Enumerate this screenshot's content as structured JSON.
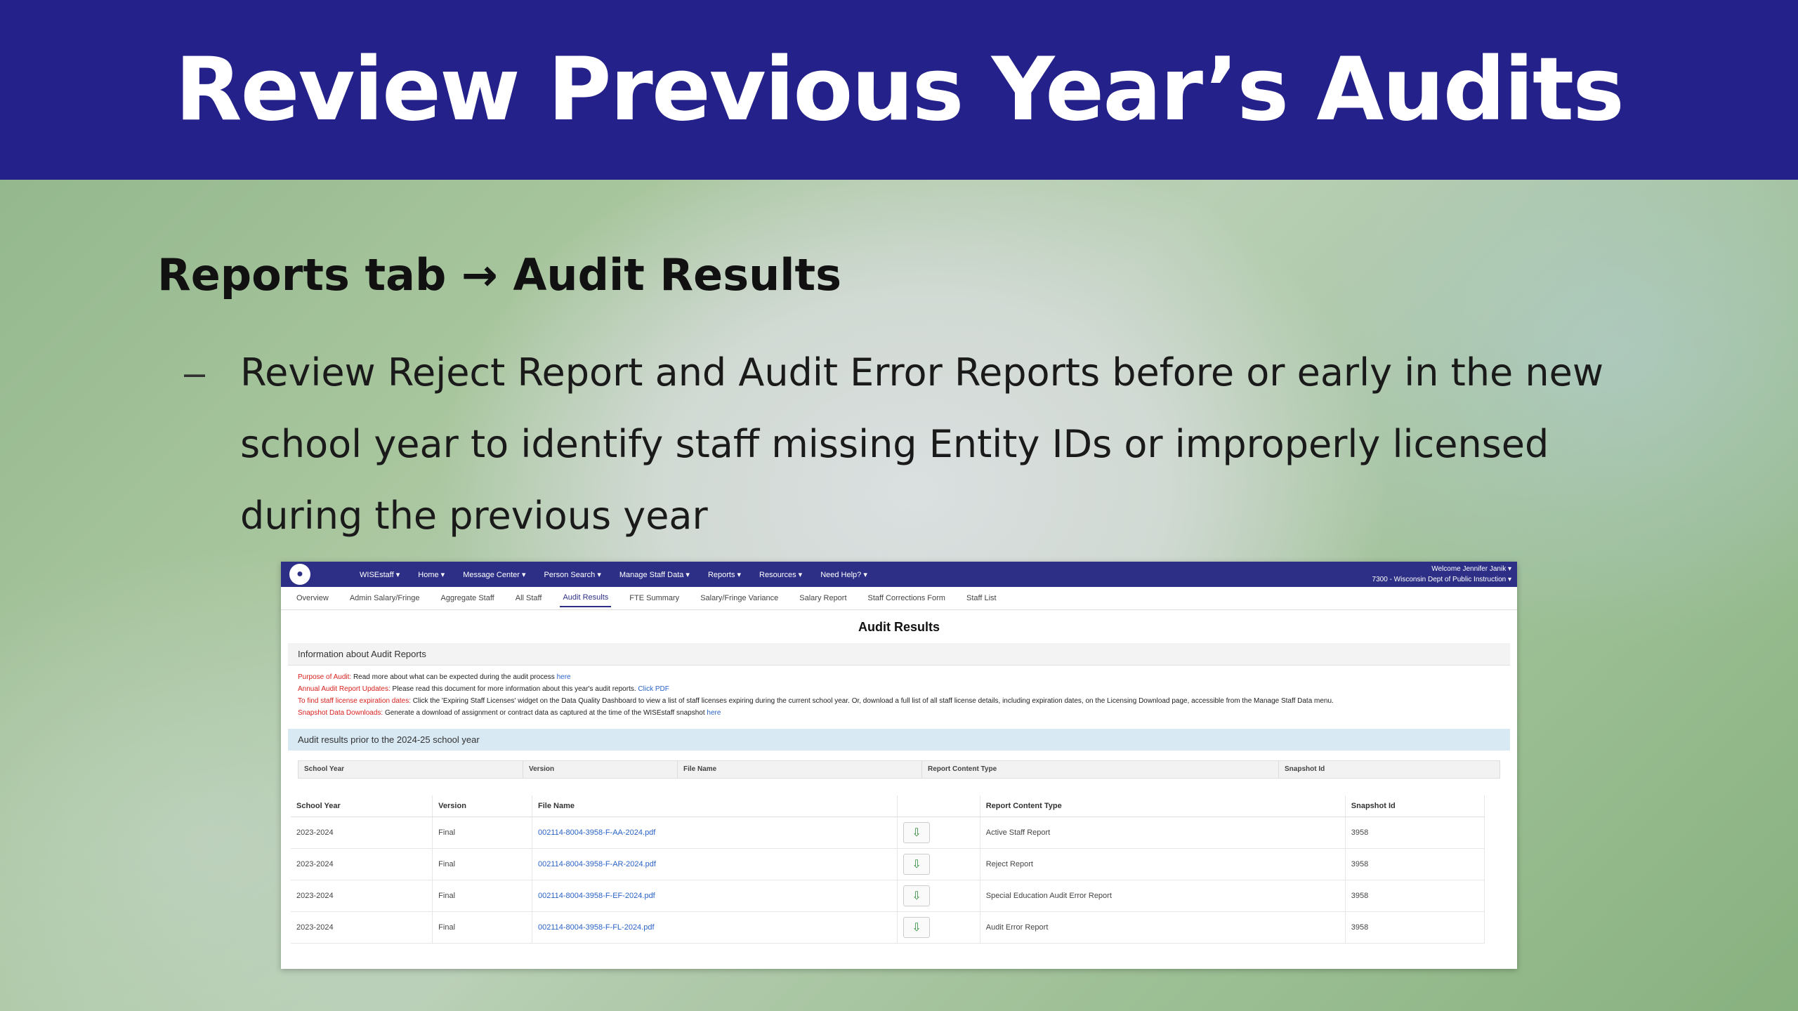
{
  "slide": {
    "title": "Review Previous Year’s Audits",
    "heading": "Reports tab → Audit Results",
    "bullet_marker": "–",
    "bullet_text": "Review Reject Report and Audit Error Reports before or early in the new school year to identify staff missing Entity IDs or improperly licensed during the previous year"
  },
  "app": {
    "logo_icon": "●",
    "menu": [
      "WISEstaff ▾",
      "Home ▾",
      "Message Center ▾",
      "Person Search ▾",
      "Manage Staff Data ▾",
      "Reports ▾",
      "Resources ▾",
      "Need Help? ▾"
    ],
    "welcome_line1": "Welcome Jennifer Janik ▾",
    "welcome_line2": "7300 - Wisconsin Dept of Public Instruction ▾",
    "subnav": [
      "Overview",
      "Admin Salary/Fringe",
      "Aggregate Staff",
      "All Staff",
      "Audit Results",
      "FTE Summary",
      "Salary/Fringe Variance",
      "Salary Report",
      "Staff Corrections Form",
      "Staff List"
    ],
    "active_subnav": "Audit Results",
    "page_title": "Audit Results",
    "info_header": "Information about Audit Reports",
    "info": {
      "purpose_label": "Purpose of Audit:",
      "purpose_text": " Read more about what can be expected during the audit process ",
      "purpose_link": "here",
      "annual_label": "Annual Audit Report Updates:",
      "annual_text": " Please read this document for more information about this year's audit reports. ",
      "annual_link": "Click PDF",
      "license_label": "To find staff license expiration dates:",
      "license_text": " Click the 'Expiring Staff Licenses' widget on the Data Quality Dashboard to view a list of staff licenses expiring during the current school year. Or, download a full list of all staff license details, including expiration dates, on the Licensing Download page, accessible from the Manage Staff Data menu.",
      "snapshot_label": "Snapshot Data Downloads:",
      "snapshot_text": " Generate a download of assignment or contract data as captured at the time of the WISEstaff snapshot ",
      "snapshot_link": "here"
    },
    "prior_header": "Audit results prior to the 2024-25 school year",
    "filter_headers": [
      "School Year",
      "Version",
      "File Name",
      "Report Content Type",
      "Snapshot Id"
    ],
    "table_headers": [
      "School Year",
      "Version",
      "File Name",
      "",
      "Report Content Type",
      "Snapshot Id"
    ],
    "download_icon": "⇩",
    "rows": [
      {
        "year": "2023-2024",
        "version": "Final",
        "file": "002114-8004-3958-F-AA-2024.pdf",
        "type": "Active Staff Report",
        "snapshot": "3958"
      },
      {
        "year": "2023-2024",
        "version": "Final",
        "file": "002114-8004-3958-F-AR-2024.pdf",
        "type": "Reject Report",
        "snapshot": "3958"
      },
      {
        "year": "2023-2024",
        "version": "Final",
        "file": "002114-8004-3958-F-EF-2024.pdf",
        "type": "Special Education Audit Error Report",
        "snapshot": "3958"
      },
      {
        "year": "2023-2024",
        "version": "Final",
        "file": "002114-8004-3958-F-FL-2024.pdf",
        "type": "Audit Error Report",
        "snapshot": "3958"
      }
    ]
  }
}
